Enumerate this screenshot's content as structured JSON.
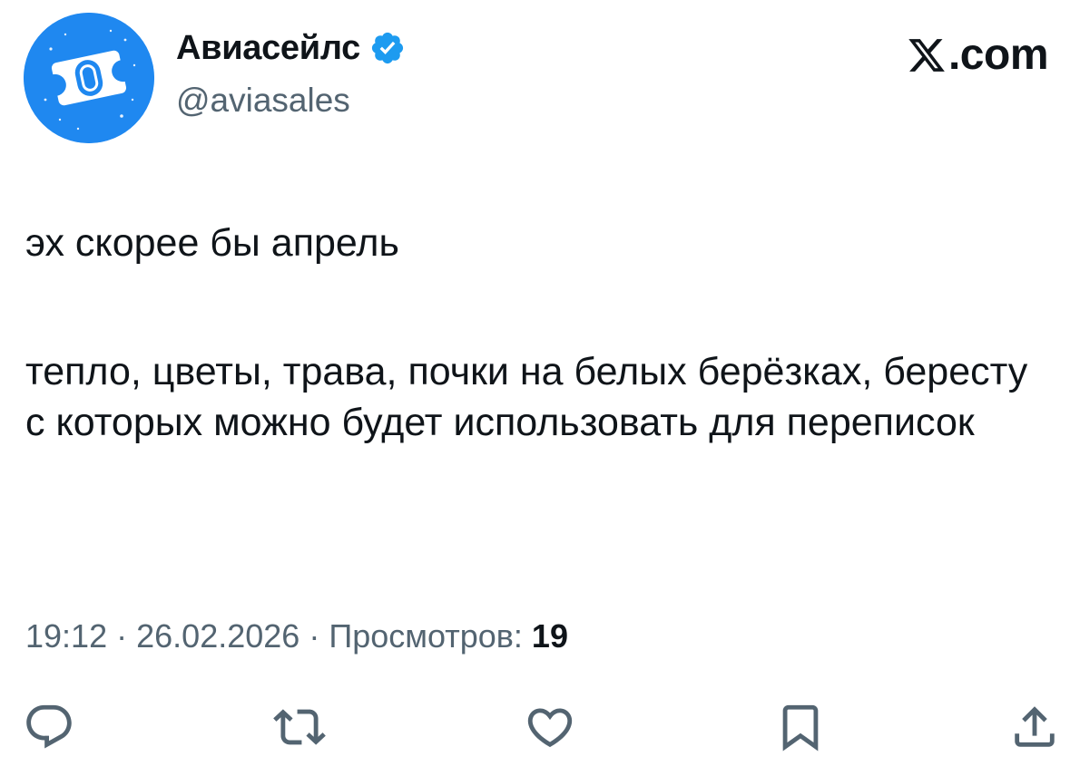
{
  "author": {
    "display_name": "Авиасейлс",
    "handle": "@aviasales",
    "verified": true,
    "avatar_icon": "aviasales-logo-icon",
    "avatar_color": "#1f88f0"
  },
  "brand": {
    "logo_icon": "x-logo-icon",
    "domain": ".com"
  },
  "tweet": {
    "paragraphs": [
      "эх скорее бы апрель",
      "тепло, цветы, трава, почки на белых берёзках, бересту с которых можно будет использовать для переписок"
    ]
  },
  "meta": {
    "time": "19:12",
    "separator": "·",
    "date": "26.02.2026",
    "views_label": "Просмотров:",
    "views_count": "19"
  },
  "actions": [
    {
      "name": "reply",
      "icon": "reply-icon"
    },
    {
      "name": "retweet",
      "icon": "retweet-icon"
    },
    {
      "name": "like",
      "icon": "heart-icon"
    },
    {
      "name": "bookmark",
      "icon": "bookmark-icon"
    },
    {
      "name": "share",
      "icon": "share-icon"
    }
  ],
  "colors": {
    "text": "#0f1419",
    "muted": "#536471",
    "verified_badge": "#1d9bf0"
  }
}
